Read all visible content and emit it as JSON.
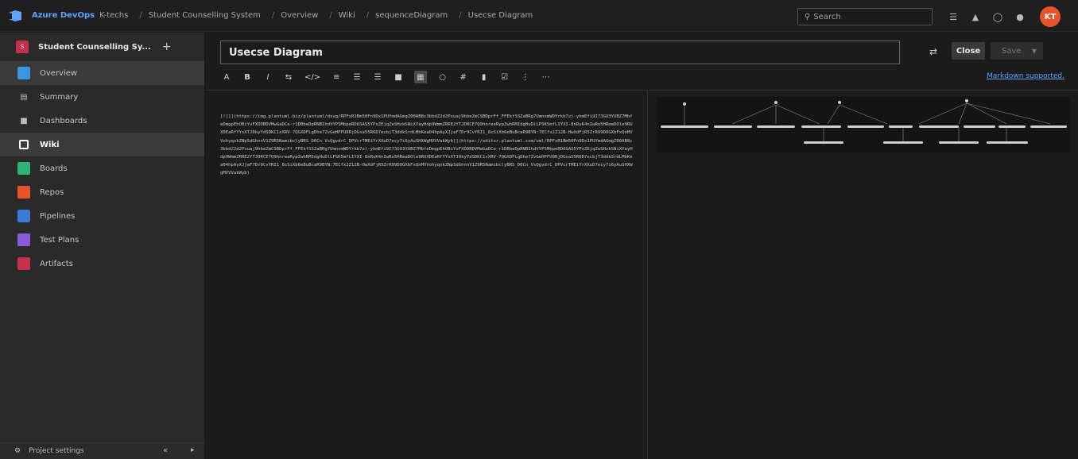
{
  "header": {
    "brand": "Azure DevOps",
    "org": "K-techs",
    "breadcrumbs": [
      "Student Counselling System",
      "Overview",
      "Wiki",
      "sequenceDiagram",
      "Usecse Diagram"
    ],
    "search_placeholder": "Search",
    "avatar_initials": "KT",
    "avatar_color": "#e8542a"
  },
  "sidebar": {
    "project_initial": "S",
    "project_name": "Student Counselling Sy...",
    "items": [
      {
        "label": "Overview",
        "color": "#3a96dd"
      },
      {
        "label": "Summary",
        "color": "#bbbbbb"
      },
      {
        "label": "Dashboards",
        "color": "#bbbbbb"
      },
      {
        "label": "Wiki",
        "color": "#ffffff"
      },
      {
        "label": "Boards",
        "color": "#2bb673"
      },
      {
        "label": "Repos",
        "color": "#e8542a"
      },
      {
        "label": "Pipelines",
        "color": "#3a7bd5"
      },
      {
        "label": "Test Plans",
        "color": "#8a5bd6"
      },
      {
        "label": "Artifacts",
        "color": "#c4314b"
      }
    ],
    "footer_label": "Project settings"
  },
  "editor": {
    "page_title": "Usecse Diagram",
    "close_label": "Close",
    "save_label": "Save",
    "markdown_link": "Markdown supported.",
    "toolbar": [
      "A",
      "B",
      "I",
      "⇆",
      "</>",
      "≡",
      "☰",
      "☰",
      "■",
      "▦",
      "○",
      "#",
      "▮",
      "☑",
      "⋮",
      "⋯"
    ],
    "code": "[![]](https://img.plantuml.biz/plantuml/dsvg/RPFxR1Bm50Fn9Dx1PUYmdAGmgZ00AB8c3bbdZ2d2Psuaj9hbeZmCSBDprFf_FFEkfSSZaBRg7UmnxmWDYrkb7z)-yhmEfi9I73GO3YUBZ7MbfeDmgpEhOBiYvFXDDBDVMwGaDCe-r1DBbeDpRNBIhdVYPSMbpeRD6SAS5YPxZEjqZeSHzkSNiXYayHdp9WmmZRRE2YTJDRCE7Q9hnreeRypZwhRMIdgHuDlLPSK5mfLIYXI-8nRuK4nIwRo5HRmaDOle9RUXDEaRfYYsXTJ0kyYdSDKC1xXRV-7QGXDFLgDhe7ZvGeHPFU8RjDGsa55R6D7ecbjT3ddkSrdLMbKea04hpAyXJjaF7Dr9CvYRI1_8cSiXb6eBuBcaR9BYN:7ECfx2Z12B-HwXdFjR5ZrR99DOGXbFxQnMVVohyqokZNpSdGhnnV1Z9R5NamibclyBRS_D0Cn_VsQgvdrC_DPVcrTMEiYrXXuD7ecy7i6yAuSHXWgMVVVakWyb]](https://editor.plantuml.com/uml/RPFxR1Bm50Fn9Dx1PUYmdAGmgZ00AB8c3bbdZ2d2Psuaj9hbeZmCSBDprFf_FFEkfSSZaBRg7UmnxmWDYrkb7z)-yhmEfi9I73GO3YUBZ7MbfeDmgpEhOBiYvFXDDBDVMwGaDCe-r1DBbeDpRNBIhdVYPSMbpeRD6SAS5YPxZEjqZeSHzkSNiXYayHdp9WmmZRRE2YTJDRCE7Q9hnreeRypZwhRMIdgHuDlLPSK5mfLIYXI-8nRuK4nIwRo5HRmaDOle9RUXDEaRfYYsXTJ0kyYdSDKC1xXRV-7QGXDFLgDhe7ZvGeHPFU8RjDGsa55R6D7ecbjT3ddkSrdLMbKea04hpAyXJjaF7Dr9CvYRI1_8cSiXb6eBuBcaR9BYN:7ECfx2Z12B-HwXdFjR5ZrR99DOGXbFxQnMVVohyqokZNpSdGhnnV1Z9R5NamibclyBRS_D0Cn_VsQgvdrC_DPVcrTMEiYrXXuD7ecy7i6yAuSHXWgMVVVakWyb)"
  }
}
